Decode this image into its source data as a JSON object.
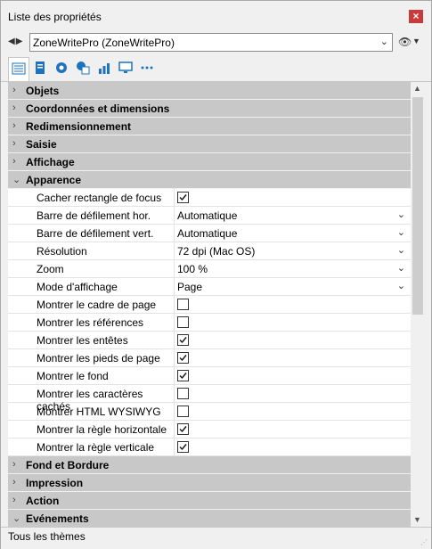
{
  "window": {
    "title": "Liste des propriétés",
    "close": "×"
  },
  "selector": {
    "nav": "◀▶",
    "value": "ZoneWritePro (ZoneWritePro)"
  },
  "tabs": [
    {
      "icon": "list-icon"
    },
    {
      "icon": "document-icon"
    },
    {
      "icon": "gear-icon"
    },
    {
      "icon": "shapes-icon"
    },
    {
      "icon": "chart-icon"
    },
    {
      "icon": "monitor-icon"
    },
    {
      "icon": "more-icon"
    }
  ],
  "grid": {
    "sections_top": [
      {
        "label": "Objets",
        "expanded": false
      },
      {
        "label": "Coordonnées et dimensions",
        "expanded": false
      },
      {
        "label": "Redimensionnement",
        "expanded": false
      },
      {
        "label": "Saisie",
        "expanded": false
      },
      {
        "label": "Affichage",
        "expanded": false
      },
      {
        "label": "Apparence",
        "expanded": true
      }
    ],
    "properties": [
      {
        "name": "Cacher rectangle de focus",
        "type": "checkbox",
        "checked": true
      },
      {
        "name": "Barre de défilement hor.",
        "type": "dropdown",
        "value": "Automatique"
      },
      {
        "name": "Barre de défilement vert.",
        "type": "dropdown",
        "value": "Automatique"
      },
      {
        "name": "Résolution",
        "type": "dropdown",
        "value": "72 dpi (Mac OS)"
      },
      {
        "name": "Zoom",
        "type": "dropdown",
        "value": "100 %"
      },
      {
        "name": "Mode d'affichage",
        "type": "dropdown",
        "value": "Page"
      },
      {
        "name": "Montrer le cadre de page",
        "type": "checkbox",
        "checked": false
      },
      {
        "name": "Montrer les références",
        "type": "checkbox",
        "checked": false
      },
      {
        "name": "Montrer les entêtes",
        "type": "checkbox",
        "checked": true
      },
      {
        "name": "Montrer les pieds de page",
        "type": "checkbox",
        "checked": true
      },
      {
        "name": "Montrer le fond",
        "type": "checkbox",
        "checked": true
      },
      {
        "name": "Montrer les caractères cachés",
        "type": "checkbox",
        "checked": false
      },
      {
        "name": "Montrer HTML WYSIWYG",
        "type": "checkbox",
        "checked": false
      },
      {
        "name": "Montrer la règle horizontale",
        "type": "checkbox",
        "checked": true
      },
      {
        "name": "Montrer la règle verticale",
        "type": "checkbox",
        "checked": true
      }
    ],
    "sections_bottom": [
      {
        "label": "Fond et Bordure",
        "expanded": false
      },
      {
        "label": "Impression",
        "expanded": false
      },
      {
        "label": "Action",
        "expanded": false
      },
      {
        "label": "Evénements",
        "expanded": true
      }
    ]
  },
  "status": {
    "text": "Tous les thèmes"
  },
  "colors": {
    "section_bg": "#c8c8c8",
    "close_bg": "#c93a3a",
    "tab_blue": "#1e73be"
  }
}
